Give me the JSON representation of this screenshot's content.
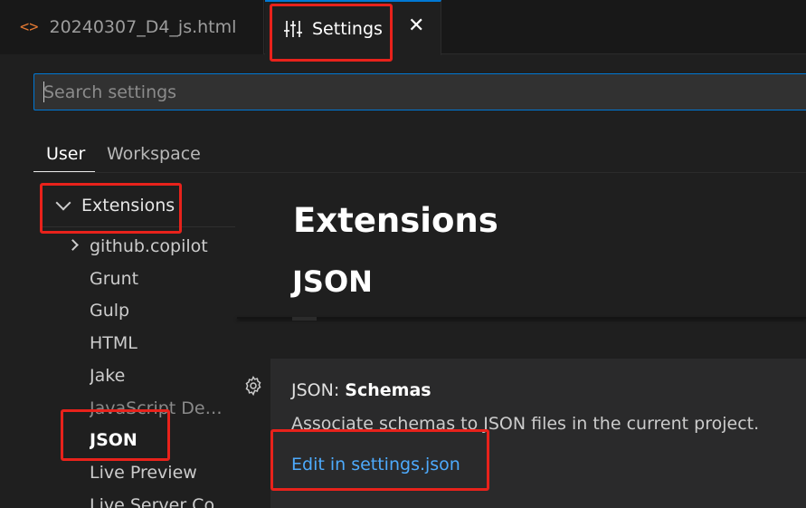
{
  "tabs": [
    {
      "label": "20240307_D4_js.html",
      "icon": "code-icon"
    },
    {
      "label": "Settings",
      "icon": "sliders-icon",
      "close": "✕"
    }
  ],
  "search": {
    "placeholder": "Search settings",
    "value": ""
  },
  "scope_tabs": {
    "user": "User",
    "workspace": "Workspace"
  },
  "toc": {
    "header": "Extensions",
    "items": [
      {
        "label": "github.copilot"
      },
      {
        "label": "Grunt"
      },
      {
        "label": "Gulp"
      },
      {
        "label": "HTML"
      },
      {
        "label": "Jake"
      },
      {
        "label": "JavaScript Debugger"
      },
      {
        "label": "JSON"
      },
      {
        "label": "Live Preview"
      },
      {
        "label": "Live Server Config"
      }
    ]
  },
  "main": {
    "section_title": "Extensions",
    "subsection_title": "JSON",
    "setting": {
      "category": "JSON: ",
      "name": "Schemas",
      "description": "Associate schemas to JSON files in the current project.",
      "link": "Edit in settings.json"
    }
  },
  "colors": {
    "accent": "#0078d4",
    "link": "#4daafc",
    "annotation": "#e8221b",
    "file_icon": "#e37933"
  }
}
